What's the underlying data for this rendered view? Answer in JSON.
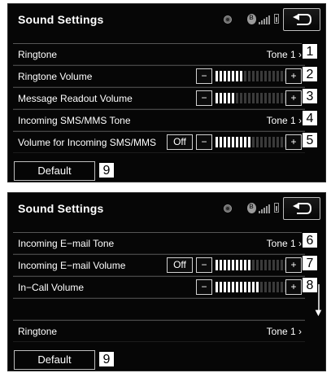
{
  "screen1": {
    "title": "Sound Settings",
    "rows": [
      {
        "label": "Ringtone",
        "value": "Tone 1 ›",
        "callout": "1"
      },
      {
        "label": "Ringtone Volume",
        "minus": "−",
        "plus": "+",
        "level": 0.4,
        "callout": "2"
      },
      {
        "label": "Message Readout Volume",
        "minus": "−",
        "plus": "+",
        "level": 0.3,
        "callout": "3"
      },
      {
        "label": "Incoming SMS/MMS Tone",
        "value": "Tone 1 ›",
        "callout": "4"
      },
      {
        "label": "Volume for Incoming SMS/MMS",
        "off": "Off",
        "minus": "−",
        "plus": "+",
        "level": 0.5,
        "callout": "5"
      }
    ],
    "default_label": "Default",
    "default_callout": "9"
  },
  "screen2": {
    "title": "Sound Settings",
    "rows": [
      {
        "label": "Incoming E−mail Tone",
        "value": "Tone 1 ›",
        "callout": "6"
      },
      {
        "label": "Incoming E−mail Volume",
        "off": "Off",
        "minus": "−",
        "plus": "+",
        "level": 0.5,
        "callout": "7"
      },
      {
        "label": "In−Call Volume",
        "minus": "−",
        "plus": "+",
        "level": 0.6,
        "callout": "8"
      },
      {
        "label": ""
      },
      {
        "label": "Ringtone",
        "value": "Tone 1 ›"
      }
    ],
    "scroll_icon": "▼",
    "default_label": "Default",
    "default_callout": "9"
  },
  "colors": {
    "bg": "#060606",
    "bar_on": "#ffffff",
    "bar_off": "#3a3a3a",
    "callout_bg": "#ffffff"
  },
  "icons": [
    "status-dot-icon",
    "bluetooth-icon",
    "signal-icon",
    "battery-icon",
    "back-arrow-icon",
    "scroll-down-icon"
  ]
}
